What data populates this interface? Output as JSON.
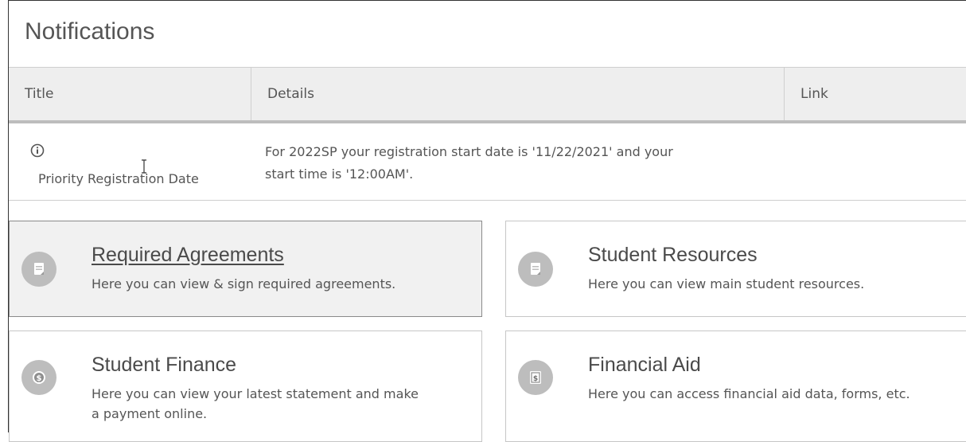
{
  "page": {
    "title": "Notifications"
  },
  "table": {
    "headers": {
      "title": "Title",
      "details": "Details",
      "link": "Link"
    },
    "rows": [
      {
        "icon": "info-icon",
        "title": "Priority Registration Date",
        "details_line1": "For 2022SP your registration start date is '11/22/2021' and your",
        "details_line2": "start time is '12:00AM'.",
        "link": ""
      }
    ]
  },
  "cards": [
    {
      "icon": "document-icon",
      "title": "Required Agreements",
      "description": "Here you can view & sign required agreements."
    },
    {
      "icon": "document-icon",
      "title": "Student Resources",
      "description": "Here you can view main student resources."
    },
    {
      "icon": "dollar-coin-icon",
      "title": "Student Finance",
      "description_line1": "Here you can view your latest statement and make",
      "description_line2": "a payment online."
    },
    {
      "icon": "dollar-bill-icon",
      "title": "Financial Aid",
      "description": "Here you can access financial aid data, forms, etc."
    }
  ],
  "colors": {
    "icon_circle": "#bdbdbd",
    "header_bg": "#eeeeee",
    "active_card_bg": "#f1f1f1"
  }
}
